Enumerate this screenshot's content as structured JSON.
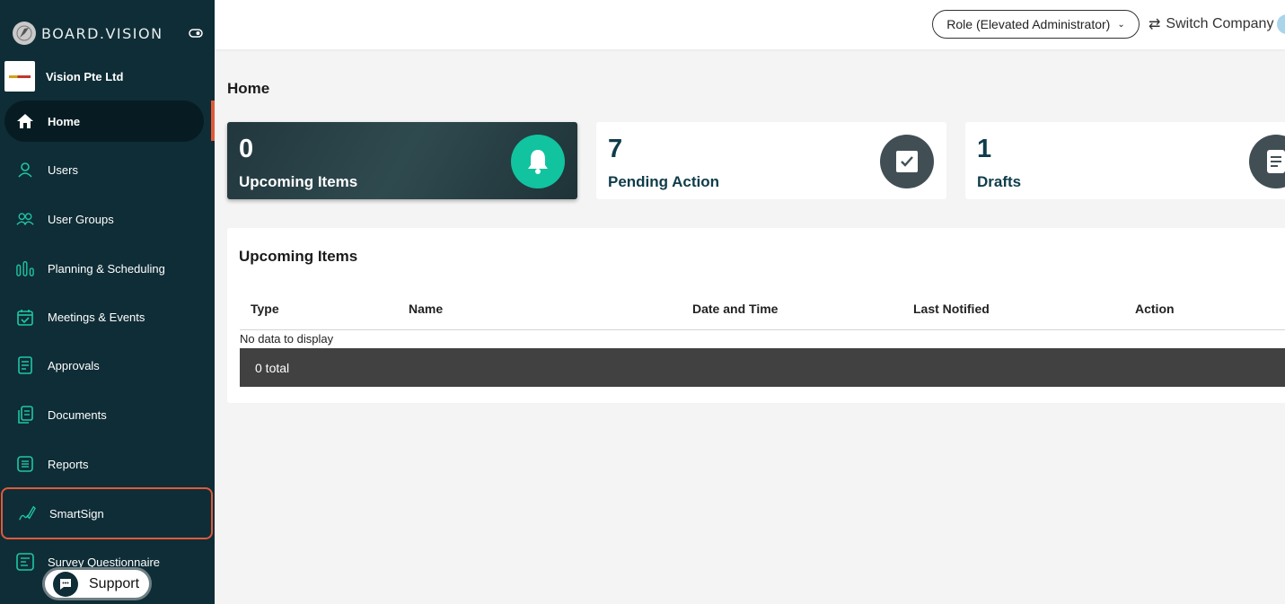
{
  "brand": {
    "name": "BOARD.VISION"
  },
  "company": {
    "name": "Vision Pte Ltd"
  },
  "sidebar": {
    "items": [
      {
        "label": "Home",
        "icon": "home-icon"
      },
      {
        "label": "Users",
        "icon": "user-icon"
      },
      {
        "label": "User Groups",
        "icon": "user-group-icon"
      },
      {
        "label": "Planning & Scheduling",
        "icon": "planning-icon"
      },
      {
        "label": "Meetings & Events",
        "icon": "calendar-icon"
      },
      {
        "label": "Approvals",
        "icon": "approval-icon"
      },
      {
        "label": "Documents",
        "icon": "documents-icon"
      },
      {
        "label": "Reports",
        "icon": "reports-icon"
      },
      {
        "label": "SmartSign",
        "icon": "smartsign-icon"
      },
      {
        "label": "Survey Questionnaire",
        "icon": "survey-icon"
      }
    ],
    "support_label": "Support"
  },
  "header": {
    "role_label": "Role (Elevated Administrator)",
    "switch_company_label": "Switch Company"
  },
  "page": {
    "title": "Home"
  },
  "cards": [
    {
      "count": "0",
      "label": "Upcoming Items",
      "icon": "bell-icon",
      "accent": "#12c3a0"
    },
    {
      "count": "7",
      "label": "Pending Action",
      "icon": "checkbox-icon"
    },
    {
      "count": "1",
      "label": "Drafts",
      "icon": "document-icon"
    }
  ],
  "upcoming": {
    "title": "Upcoming Items",
    "columns": [
      "Type",
      "Name",
      "Date and Time",
      "Last Notified",
      "Action"
    ],
    "empty_text": "No data to display",
    "total_text": "0 total"
  },
  "colors": {
    "sidebar_bg": "#0f2d36",
    "accent": "#12c3a0",
    "highlight": "#e05a3a",
    "icon_teal": "#1fc7a6"
  }
}
